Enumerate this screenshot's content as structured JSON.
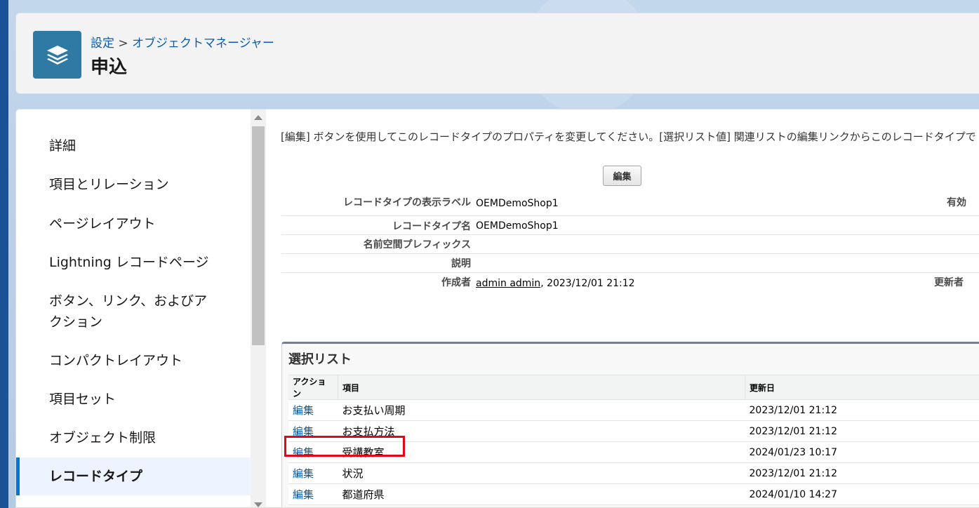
{
  "header": {
    "breadcrumb_setup": "設定",
    "breadcrumb_sep": ">",
    "breadcrumb_object_manager": "オブジェクトマネージャー",
    "title": "申込",
    "icon": "layers-icon"
  },
  "sidebar": {
    "items": [
      {
        "label": "詳細"
      },
      {
        "label": "項目とリレーション"
      },
      {
        "label": "ページレイアウト"
      },
      {
        "label": "Lightning レコードページ"
      },
      {
        "label": "ボタン、リンク、およびア"
      },
      {
        "label": "クション"
      },
      {
        "label": "コンパクトレイアウト"
      },
      {
        "label": "項目セット"
      },
      {
        "label": "オブジェクト制限"
      },
      {
        "label": "レコードタイプ"
      }
    ],
    "active_index": 9
  },
  "content": {
    "description": "[編集] ボタンを使用してこのレコードタイプのプロパティを変更してください。[選択リスト値] 関連リストの編集リンクからこのレコードタイプで",
    "edit_button": "編集",
    "details": {
      "display_label_label": "レコードタイプの表示ラベル",
      "display_label_value": "OEMDemoShop1",
      "active_label": "有効",
      "name_label": "レコードタイプ名",
      "name_value": "OEMDemoShop1",
      "namespace_label": "名前空間プレフィックス",
      "description_label": "説明",
      "created_by_label": "作成者",
      "created_by_user": "admin admin",
      "created_by_date": ", 2023/12/01 21:12",
      "modified_by_label": "更新者"
    }
  },
  "picklist": {
    "title": "選択リスト",
    "columns": {
      "action": "アクション",
      "field": "項目",
      "updated": "更新日"
    },
    "rows": [
      {
        "action": "編集",
        "field": "お支払い周期",
        "updated": "2023/12/01 21:12"
      },
      {
        "action": "編集",
        "field": "お支払方法",
        "updated": "2023/12/01 21:12"
      },
      {
        "action": "編集",
        "field": "受講教室",
        "updated": "2024/01/23 10:17"
      },
      {
        "action": "編集",
        "field": "状況",
        "updated": "2023/12/01 21:12"
      },
      {
        "action": "編集",
        "field": "都道府県",
        "updated": "2024/01/10 14:27"
      }
    ]
  },
  "colors": {
    "accent": "#0176d3",
    "link": "#015ba7",
    "highlight": "#e30613",
    "icon_bg": "#2e7aa4"
  }
}
